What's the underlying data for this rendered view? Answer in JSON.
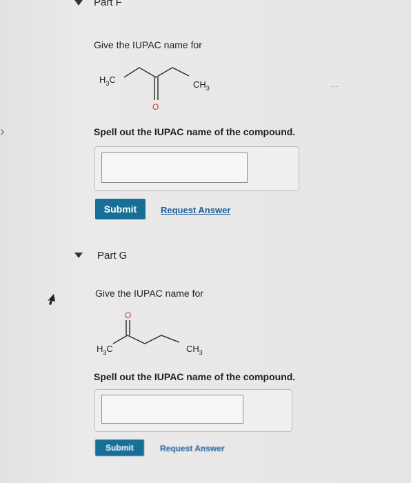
{
  "partF": {
    "title": "Part F",
    "prompt": "Give the IUPAC name for",
    "molecule": {
      "left_group": "H3C",
      "right_group": "CH3",
      "oxygen": "O"
    },
    "instruction": "Spell out the IUPAC name of the compound.",
    "answer_value": "",
    "submit_label": "Submit",
    "request_label": "Request Answer"
  },
  "partG": {
    "title": "Part G",
    "prompt": "Give the IUPAC name for",
    "molecule": {
      "left_group": "H3C",
      "right_group": "CH3",
      "oxygen": "O"
    },
    "instruction": "Spell out the IUPAC name of the compound.",
    "answer_value": "",
    "submit_label": "Submit",
    "request_label": "Request Answer"
  },
  "colors": {
    "accent": "#176f97",
    "link": "#1f5e9c",
    "oxygen": "#c0392b"
  }
}
